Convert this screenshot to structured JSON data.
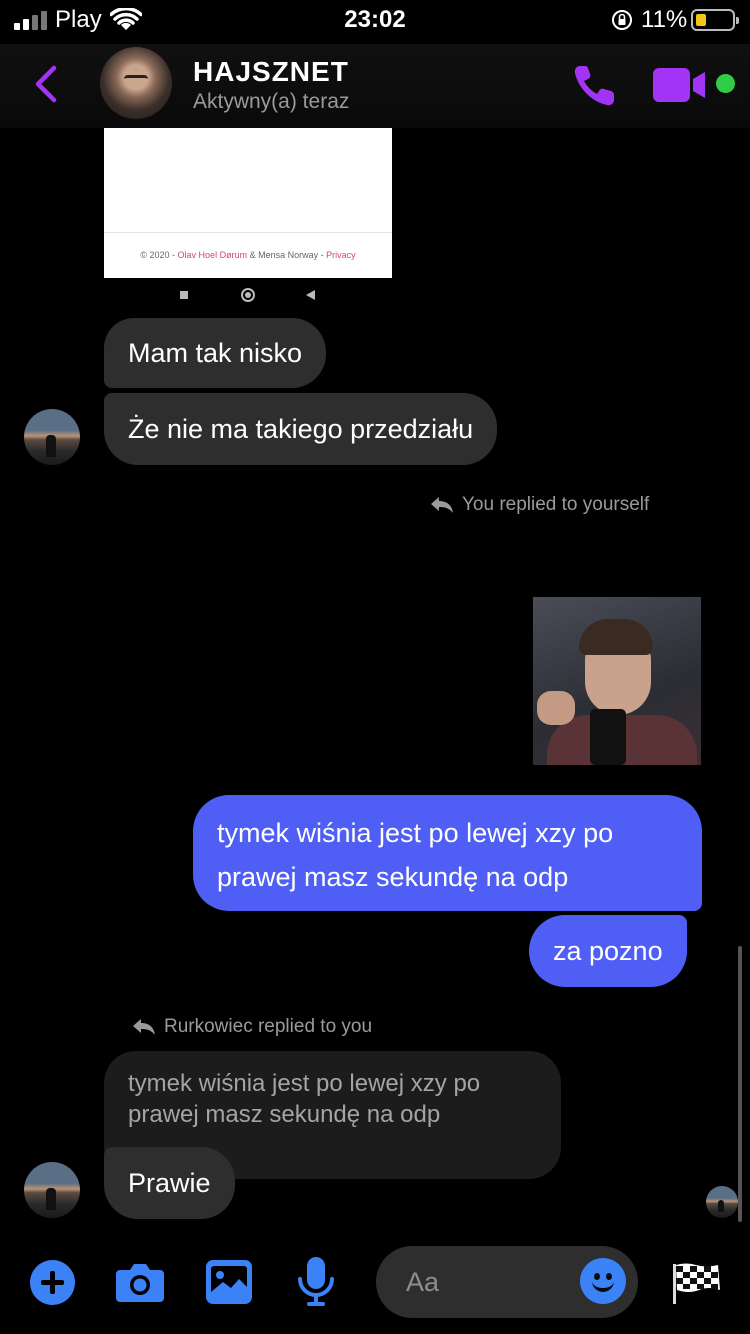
{
  "status_bar": {
    "carrier": "Play",
    "time": "23:02",
    "battery_percent": "11%",
    "battery_level": 0.11,
    "icons": [
      "signal-icon",
      "wifi-icon",
      "rotation-lock-icon",
      "battery-icon"
    ]
  },
  "header": {
    "name": "HAJSZNET",
    "status": "Aktywny(a) teraz",
    "accent_color": "#a234f5",
    "online_color": "#31cc46"
  },
  "shared_screenshot": {
    "footer_prefix": "© 2020 - ",
    "footer_author": "Olav Hoel Dørum",
    "footer_middle": " & Mensa Norway - ",
    "footer_link": "Privacy"
  },
  "messages": {
    "m1": "Mam tak nisko",
    "m2": "Że nie ma takiego przedziału",
    "reply_note_1": "You replied to yourself",
    "m3": "tymek wiśnia jest po lewej xzy po prawej masz sekundę na odp",
    "m4": "za pozno",
    "reply_note_2": "Rurkowiec replied to you",
    "quoted": "tymek wiśnia jest po lewej xzy po prawej masz sekundę na odp",
    "m5": "Prawie"
  },
  "composer": {
    "placeholder": "Aa",
    "accent_color": "#3b82f6"
  },
  "colors": {
    "outgoing_bubble": "#4f5ff5",
    "incoming_bubble": "#2e2e2e",
    "background": "#000000"
  }
}
